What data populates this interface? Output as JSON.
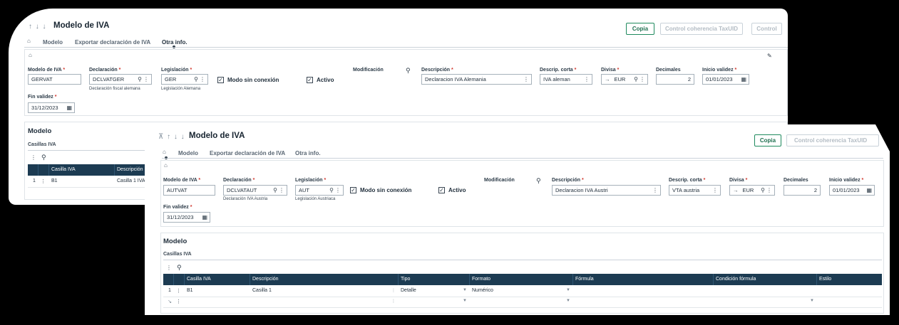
{
  "back": {
    "arrows": "↑ ↓ ↓",
    "title": "Modelo de IVA",
    "tabs": [
      "Modelo",
      "Exportar declaración de IVA",
      "Otra info."
    ],
    "buttons": [
      "Copia",
      "Control coherencia TaxUID",
      "Control"
    ],
    "labels": {
      "modelo": "Modelo de IVA",
      "declaracion": "Declaración",
      "legislacion": "Legislación",
      "modificacion": "Modificación",
      "descripcion": "Descripción",
      "descrip_corta": "Descrip. corta",
      "divisa": "Divisa",
      "decimales": "Decimales",
      "inicio": "Inicio validez",
      "fin": "Fin validez"
    },
    "values": {
      "modelo": "GERVAT",
      "declaracion": "DCLVATGER",
      "declaracion_sub": "Declaración fiscal alemana",
      "legislacion": "GER",
      "legislacion_sub": "Legislación Alemana",
      "descripcion": "Declaracion IVA Alemania",
      "descrip_corta": "IVA aleman",
      "divisa": "EUR",
      "decimales": "2",
      "inicio": "01/01/2023",
      "fin": "31/12/2023"
    },
    "checks": {
      "offline": "Modo sin conexión",
      "activo": "Activo"
    },
    "section": "Modelo",
    "subsection": "Casillas IVA",
    "grid": {
      "headers": [
        "Casilla IVA",
        "Descripción"
      ],
      "rows": [
        {
          "num": "1",
          "casilla": "B1",
          "descripcion": "Casilla 1 IVA"
        }
      ]
    }
  },
  "front": {
    "arrows": "⊼ ↑ ↓ ↓",
    "title": "Modelo de IVA",
    "tabs": [
      "Modelo",
      "Exportar declaración de IVA",
      "Otra info."
    ],
    "buttons": [
      "Copia",
      "Control coherencia TaxUID"
    ],
    "labels": {
      "modelo": "Modelo de IVA",
      "declaracion": "Declaración",
      "legislacion": "Legislación",
      "modificacion": "Modificación",
      "descripcion": "Descripción",
      "descrip_corta": "Descrip. corta",
      "divisa": "Divisa",
      "decimales": "Decimales",
      "inicio": "Inicio validez",
      "fin": "Fin validez"
    },
    "values": {
      "modelo": "AUTVAT",
      "declaracion": "DCLVATAUT",
      "declaracion_sub": "Declaración IVA Austria",
      "legislacion": "AUT",
      "legislacion_sub": "Legislación Austriaca",
      "descripcion": "Declaracion IVA Austri",
      "descrip_corta": "VTA austria",
      "divisa": "EUR",
      "decimales": "2",
      "inicio": "01/01/2023",
      "fin": "31/12/2023"
    },
    "checks": {
      "offline": "Modo sin conexión",
      "activo": "Activo"
    },
    "section": "Modelo",
    "subsection": "Casillas IVA",
    "grid": {
      "headers": [
        "Casilla IVA",
        "Descripción",
        "Tipo",
        "Formato",
        "Fórmula",
        "Condición fórmula",
        "Estilo"
      ],
      "rows": [
        {
          "num": "1",
          "casilla": "B1",
          "descripcion": "Casilla 1",
          "tipo": "Detalle",
          "formato": "Numérico"
        }
      ]
    }
  },
  "colors": {
    "accent": "#1f8a5e",
    "grid_header": "#1c3b52",
    "required": "#d0352b"
  }
}
